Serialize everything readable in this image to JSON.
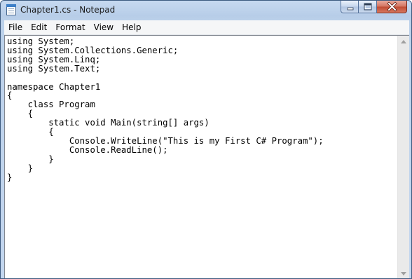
{
  "window": {
    "title": "Chapter1.cs - Notepad",
    "app_icon": "notepad-icon",
    "controls": {
      "minimize_icon": "minimize-icon",
      "maximize_icon": "maximize-icon",
      "close_icon": "close-icon"
    }
  },
  "menubar": {
    "items": [
      {
        "label": "File"
      },
      {
        "label": "Edit"
      },
      {
        "label": "Format"
      },
      {
        "label": "View"
      },
      {
        "label": "Help"
      }
    ]
  },
  "editor": {
    "content": "using System;\nusing System.Collections.Generic;\nusing System.Linq;\nusing System.Text;\n\nnamespace Chapter1\n{\n    class Program\n    {\n        static void Main(string[] args)\n        {\n            Console.WriteLine(\"This is my First C# Program\");\n            Console.ReadLine();\n        }\n    }\n}"
  },
  "scrollbar": {
    "up_icon": "scroll-up-arrow-icon",
    "down_icon": "scroll-down-arrow-icon"
  },
  "colors": {
    "title_bar": "#c6d9f0",
    "close_button": "#c04a32",
    "menu_bar": "#f5f6f7",
    "editor_background": "#ffffff"
  }
}
